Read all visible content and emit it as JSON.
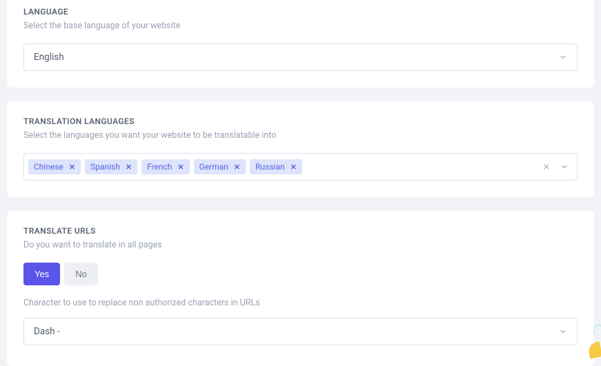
{
  "language": {
    "title": "LANGUAGE",
    "desc": "Select the base language of your website",
    "selected": "English"
  },
  "translation": {
    "title": "TRANSLATION LANGUAGES",
    "desc": "Select the languages you want your website to be translatable into",
    "tags": [
      "Chinese",
      "Spanish",
      "French",
      "German",
      "Russian"
    ]
  },
  "translate_urls": {
    "title": "TRANSLATE URLS",
    "desc": "Do you want to translate in all pages",
    "yes": "Yes",
    "no": "No",
    "char_desc": "Character to use to replace non authorized characters in URLs",
    "char_selected": "Dash -"
  }
}
